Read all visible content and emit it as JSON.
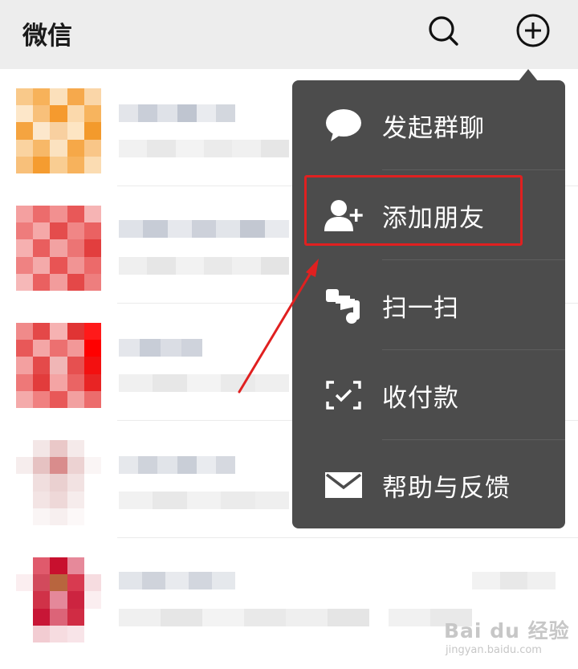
{
  "header": {
    "title": "微信",
    "search_icon": "search-icon",
    "plus_icon": "plus-circle-icon",
    "background": "#ededed"
  },
  "menu": {
    "background": "#4c4c4c",
    "items": [
      {
        "label": "发起群聊",
        "icon": "chat-bubble-icon"
      },
      {
        "label": "添加朋友",
        "icon": "add-friend-icon",
        "highlighted": true
      },
      {
        "label": "扫一扫",
        "icon": "scan-icon"
      },
      {
        "label": "收付款",
        "icon": "payment-icon"
      },
      {
        "label": "帮助与反馈",
        "icon": "mail-icon"
      }
    ],
    "highlight_color": "#e02020"
  },
  "chat_list": {
    "row_count": 5,
    "content": "pixelated"
  },
  "watermark": {
    "brand": "Bai du 经验",
    "url": "jingyan.baidu.com"
  }
}
